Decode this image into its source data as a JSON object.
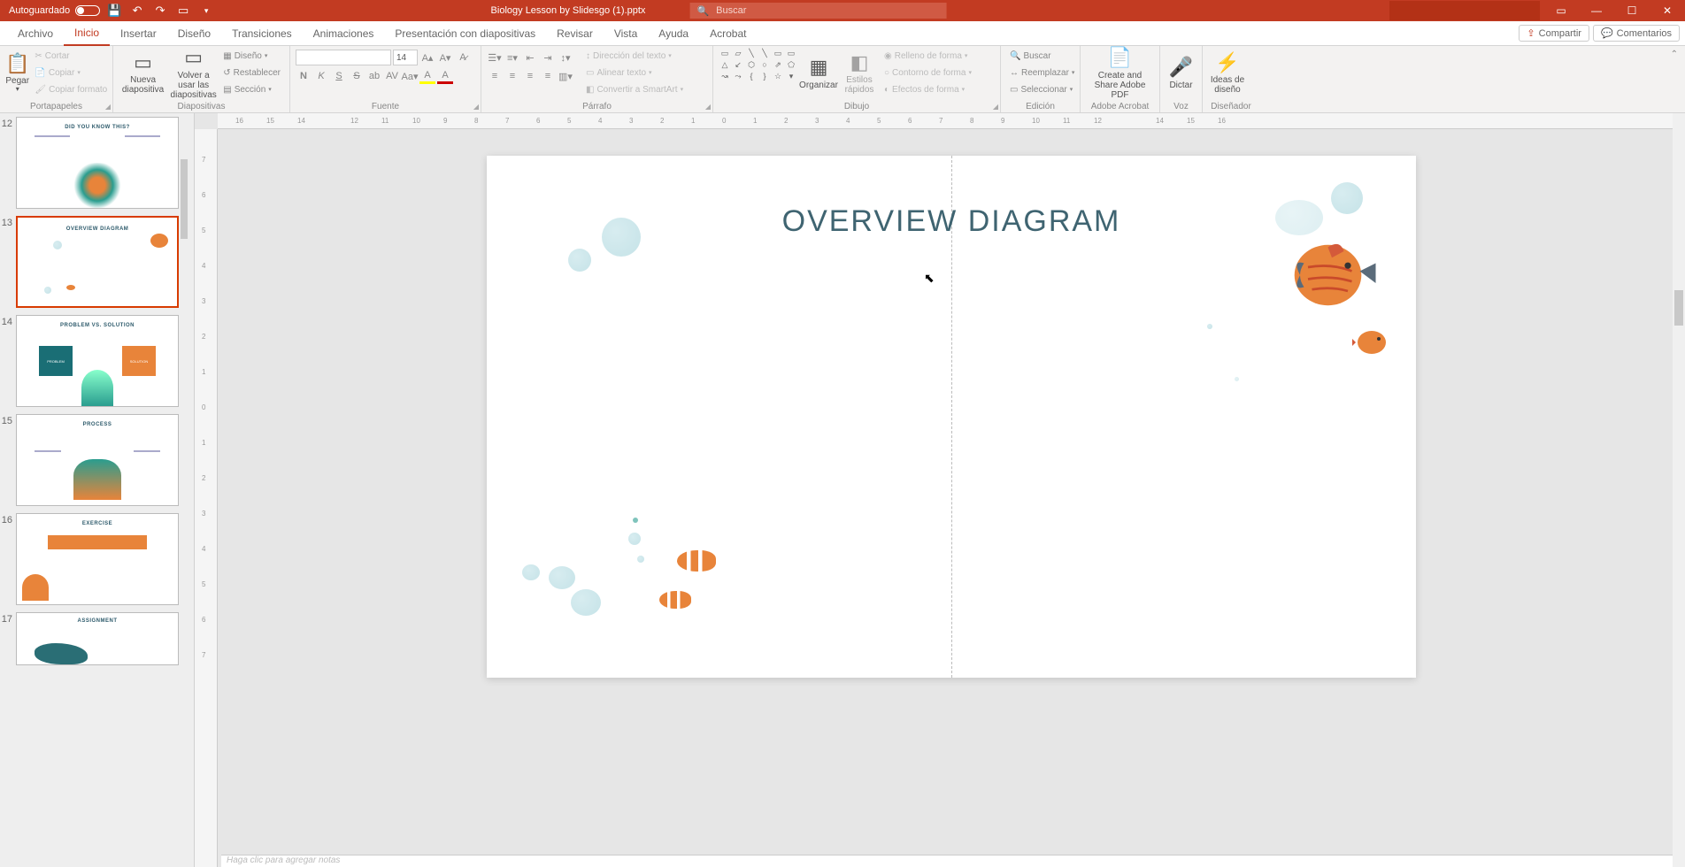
{
  "titleBar": {
    "autoSave": "Autoguardado",
    "fileName": "Biology Lesson by Slidesgo (1).pptx",
    "searchPlaceholder": "Buscar"
  },
  "menu": {
    "archivo": "Archivo",
    "inicio": "Inicio",
    "insertar": "Insertar",
    "diseno": "Diseño",
    "transiciones": "Transiciones",
    "animaciones": "Animaciones",
    "presentacion": "Presentación con diapositivas",
    "revisar": "Revisar",
    "vista": "Vista",
    "ayuda": "Ayuda",
    "acrobat": "Acrobat",
    "compartir": "Compartir",
    "comentarios": "Comentarios"
  },
  "ribbon": {
    "portapapeles": {
      "label": "Portapapeles",
      "pegar": "Pegar",
      "cortar": "Cortar",
      "copiar": "Copiar",
      "copiarFormato": "Copiar formato"
    },
    "diapositivas": {
      "label": "Diapositivas",
      "nueva": "Nueva diapositiva",
      "volver": "Volver a usar las diapositivas",
      "disenoBtn": "Diseño",
      "restablecer": "Restablecer",
      "seccion": "Sección"
    },
    "fuente": {
      "label": "Fuente",
      "size": "14",
      "n": "N",
      "k": "K",
      "s": "S"
    },
    "parrafo": {
      "label": "Párrafo",
      "direccion": "Dirección del texto",
      "alinear": "Alinear texto",
      "smartart": "Convertir a SmartArt"
    },
    "dibujo": {
      "label": "Dibujo",
      "organizar": "Organizar",
      "estilos": "Estilos rápidos",
      "relleno": "Relleno de forma",
      "contorno": "Contorno de forma",
      "efectos": "Efectos de forma"
    },
    "edicion": {
      "label": "Edición",
      "buscar": "Buscar",
      "reemplazar": "Reemplazar",
      "seleccionar": "Seleccionar"
    },
    "adobe": {
      "label": "Adobe Acrobat",
      "btn": "Create and Share Adobe PDF"
    },
    "voz": {
      "label": "Voz",
      "dictar": "Dictar"
    },
    "disenador": {
      "label": "Diseñador",
      "ideas": "Ideas de diseño"
    }
  },
  "thumbs": {
    "n12": "12",
    "t12": "DID YOU KNOW THIS?",
    "n13": "13",
    "t13": "OVERVIEW DIAGRAM",
    "n14": "14",
    "t14": "PROBLEM VS. SOLUTION",
    "prob": "PROBLEM",
    "sol": "SOLUTION",
    "n15": "15",
    "t15": "PROCESS",
    "n16": "16",
    "t16": "EXERCISE",
    "n17": "17",
    "t17": "ASSIGNMENT"
  },
  "slide": {
    "title": "OVERVIEW DIAGRAM"
  },
  "notes": {
    "placeholder": "Haga clic para agregar notas"
  }
}
